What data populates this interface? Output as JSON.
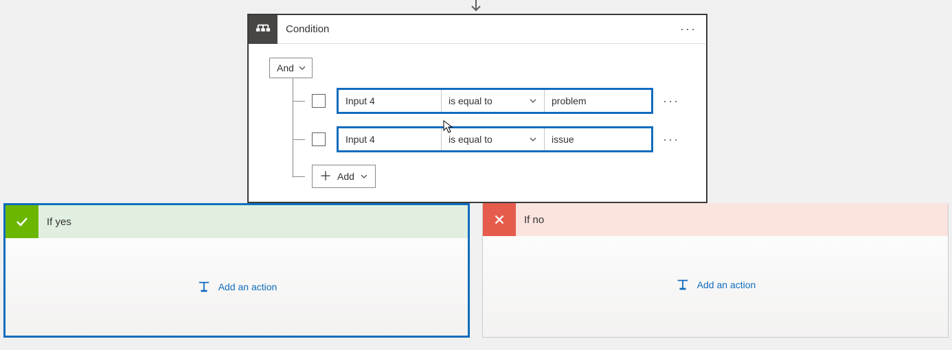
{
  "condition": {
    "title": "Condition",
    "group_operator": "And",
    "add_label": "Add",
    "rows": [
      {
        "left": "Input 4",
        "operator": "is equal to",
        "right": "problem"
      },
      {
        "left": "Input 4",
        "operator": "is equal to",
        "right": "issue"
      }
    ]
  },
  "branches": {
    "yes": {
      "title": "If yes",
      "add_action_label": "Add an action"
    },
    "no": {
      "title": "If no",
      "add_action_label": "Add an action"
    }
  },
  "icons": {
    "condition": "condition-icon",
    "ellipsis": "…",
    "check": "check-icon",
    "cross": "cross-icon",
    "add_action": "add-action-icon"
  }
}
